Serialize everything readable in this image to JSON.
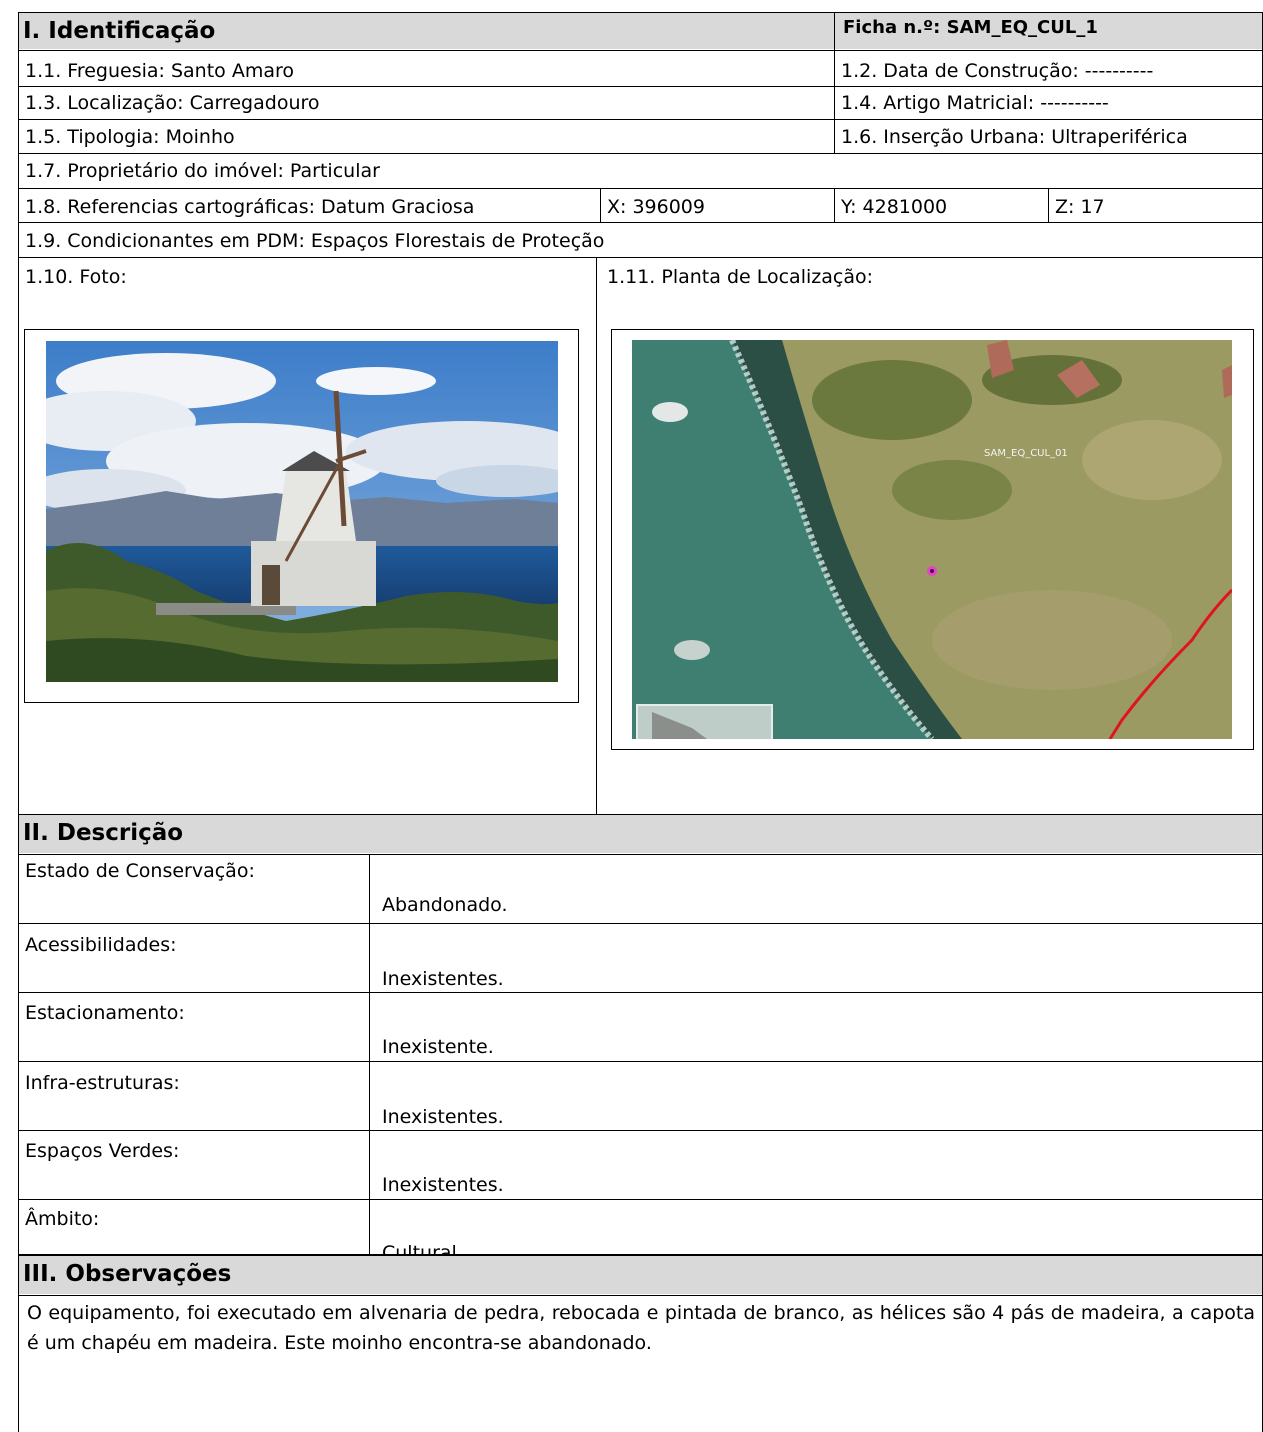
{
  "sections": {
    "identificacao": "I. Identificação",
    "descricao": "II. Descrição",
    "observacoes": "III. Observações"
  },
  "ficha": "Ficha n.º: SAM_EQ_CUL_1",
  "fields": {
    "freguesia": "1.1. Freguesia: Santo Amaro",
    "data_construcao": "1.2. Data de Construção: ----------",
    "localizacao": "1.3. Localização: Carregadouro",
    "artigo_matricial": "1.4. Artigo Matricial: ----------",
    "tipologia": "1.5. Tipologia: Moinho",
    "insercao_urbana": "1.6. Inserção Urbana: Ultraperiférica",
    "proprietario": "1.7. Proprietário do imóvel: Particular",
    "referencias": "1.8. Referencias cartográficas: Datum Graciosa",
    "x": "X: 396009",
    "y": "Y: 4281000",
    "z": "Z: 17",
    "condicionantes": "1.9. Condicionantes em PDM: Espaços Florestais de Proteção",
    "foto": "1.10. Foto:",
    "planta": "1.11. Planta de Localização:"
  },
  "map_label": "SAM_EQ_CUL_01",
  "descricao": [
    {
      "label": "Estado de Conservação:",
      "value": "Abandonado."
    },
    {
      "label": "Acessibilidades:",
      "value": "Inexistentes."
    },
    {
      "label": "Estacionamento:",
      "value": "Inexistente."
    },
    {
      "label": "Infra-estruturas:",
      "value": "Inexistentes."
    },
    {
      "label": "Espaços Verdes:",
      "value": "Inexistentes."
    },
    {
      "label": "Âmbito:",
      "value": "Cultural."
    }
  ],
  "observacoes_text": "O equipamento, foi executado em alvenaria de pedra, rebocada e pintada de branco, as hélices são 4 pás de madeira, a capota é um chapéu em madeira. Este moinho encontra-se abandonado.",
  "colors": {
    "header_bg": "#d9d9d9",
    "map_line": "#e0141e"
  }
}
